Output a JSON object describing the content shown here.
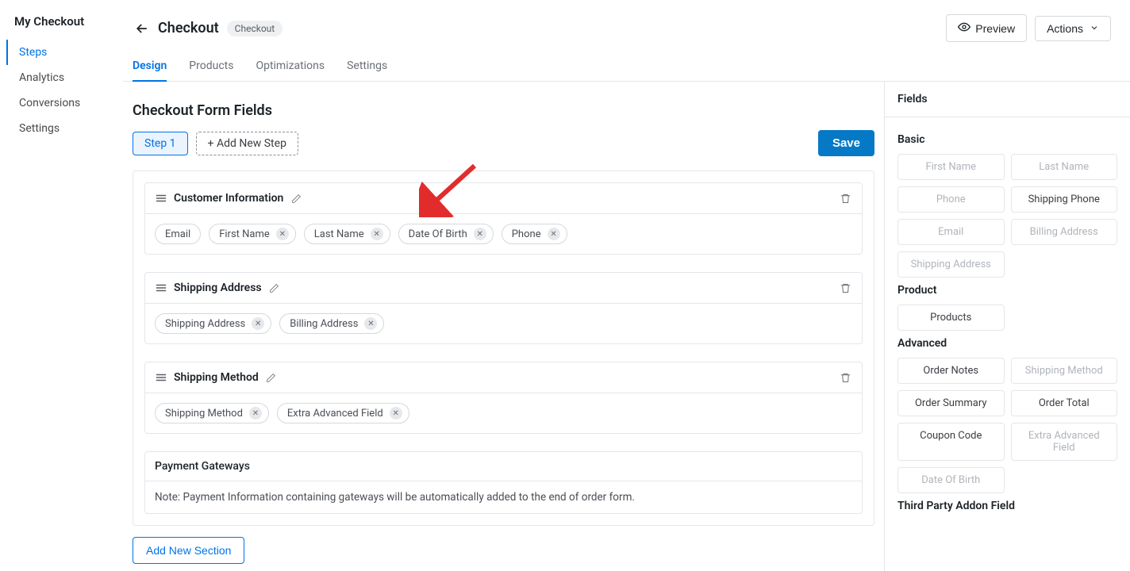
{
  "sidebar": {
    "title": "My Checkout",
    "items": [
      {
        "label": "Steps",
        "active": true
      },
      {
        "label": "Analytics",
        "active": false
      },
      {
        "label": "Conversions",
        "active": false
      },
      {
        "label": "Settings",
        "active": false
      }
    ]
  },
  "header": {
    "title": "Checkout",
    "badge": "Checkout",
    "preview_label": "Preview",
    "actions_label": "Actions"
  },
  "tabs": [
    {
      "label": "Design",
      "active": true
    },
    {
      "label": "Products",
      "active": false
    },
    {
      "label": "Optimizations",
      "active": false
    },
    {
      "label": "Settings",
      "active": false
    }
  ],
  "content": {
    "title": "Checkout Form Fields",
    "step_label": "Step 1",
    "add_step_label": "+ Add New Step",
    "save_label": "Save",
    "sections": [
      {
        "title": "Customer Information",
        "fields": [
          {
            "label": "Email",
            "removable": false
          },
          {
            "label": "First Name",
            "removable": true
          },
          {
            "label": "Last Name",
            "removable": true
          },
          {
            "label": "Date Of Birth",
            "removable": true
          },
          {
            "label": "Phone",
            "removable": true
          }
        ]
      },
      {
        "title": "Shipping Address",
        "fields": [
          {
            "label": "Shipping Address",
            "removable": true
          },
          {
            "label": "Billing Address",
            "removable": true
          }
        ]
      },
      {
        "title": "Shipping Method",
        "fields": [
          {
            "label": "Shipping Method",
            "removable": true
          },
          {
            "label": "Extra Advanced Field",
            "removable": true
          }
        ]
      }
    ],
    "payment": {
      "title": "Payment Gateways",
      "note": "Note: Payment Information containing gateways will be automatically added to the end of order form."
    },
    "add_section_label": "Add New Section"
  },
  "fields_panel": {
    "title": "Fields",
    "groups": [
      {
        "title": "Basic",
        "tiles": [
          {
            "label": "First Name",
            "disabled": true
          },
          {
            "label": "Last Name",
            "disabled": true
          },
          {
            "label": "Phone",
            "disabled": true
          },
          {
            "label": "Shipping Phone",
            "disabled": false
          },
          {
            "label": "Email",
            "disabled": true
          },
          {
            "label": "Billing Address",
            "disabled": true
          },
          {
            "label": "Shipping Address",
            "disabled": true
          }
        ]
      },
      {
        "title": "Product",
        "tiles": [
          {
            "label": "Products",
            "disabled": false
          }
        ]
      },
      {
        "title": "Advanced",
        "tiles": [
          {
            "label": "Order Notes",
            "disabled": false
          },
          {
            "label": "Shipping Method",
            "disabled": true
          },
          {
            "label": "Order Summary",
            "disabled": false
          },
          {
            "label": "Order Total",
            "disabled": false
          },
          {
            "label": "Coupon Code",
            "disabled": false
          },
          {
            "label": "Extra Advanced Field",
            "disabled": true
          },
          {
            "label": "Date Of Birth",
            "disabled": true
          }
        ]
      },
      {
        "title": "Third Party Addon Field",
        "tiles": []
      }
    ]
  }
}
